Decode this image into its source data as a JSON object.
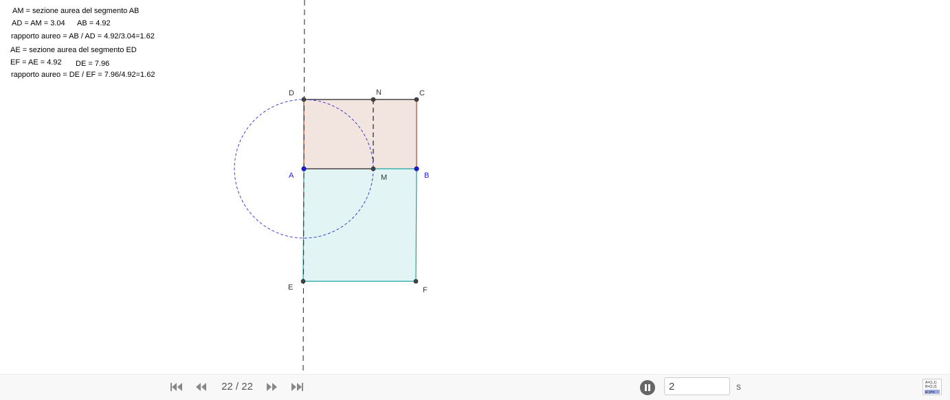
{
  "construction_info": {
    "line1": "AM = sezione aurea del segmento AB",
    "line2a": "AD = AM = 3.04",
    "line2b": "AB = 4.92",
    "line3": "rapporto aureo = AB / AD = 4.92/3.04=1.62",
    "line4": "AE = sezione aurea del segmento ED",
    "line5a": "EF = AE = 4.92",
    "line5b": "DE = 7.96",
    "line6": "rapporto aureo = DE / EF = 7.96/4.92=1.62"
  },
  "points": {
    "D": "D",
    "N": "N",
    "C": "C",
    "A": "A",
    "M": "M",
    "B": "B",
    "E": "E",
    "F": "F"
  },
  "colors": {
    "upper_rect_fill": "#f2e5df",
    "upper_rect_edge": "#b04a1c",
    "lower_rect_fill": "#e3f4f4",
    "lower_rect_edge": "#1aa3a3",
    "circle": "#2a2ad6",
    "point_blue": "#1c1cd9",
    "point_dark": "#444444",
    "dashed_line": "#333333"
  },
  "playback": {
    "counter": "22 / 22",
    "speed_value": "2",
    "speed_unit": "s"
  },
  "icons": {
    "first": "skip-to-start-icon",
    "prev": "step-back-icon",
    "next": "step-forward-icon",
    "last": "skip-to-end-icon",
    "pause": "pause-icon",
    "algebra": "algebra-view-icon"
  },
  "algebra_icon_text": {
    "row1": "A=(1,1)",
    "row2": "B=(2,2)",
    "row3": "a: y=x"
  }
}
